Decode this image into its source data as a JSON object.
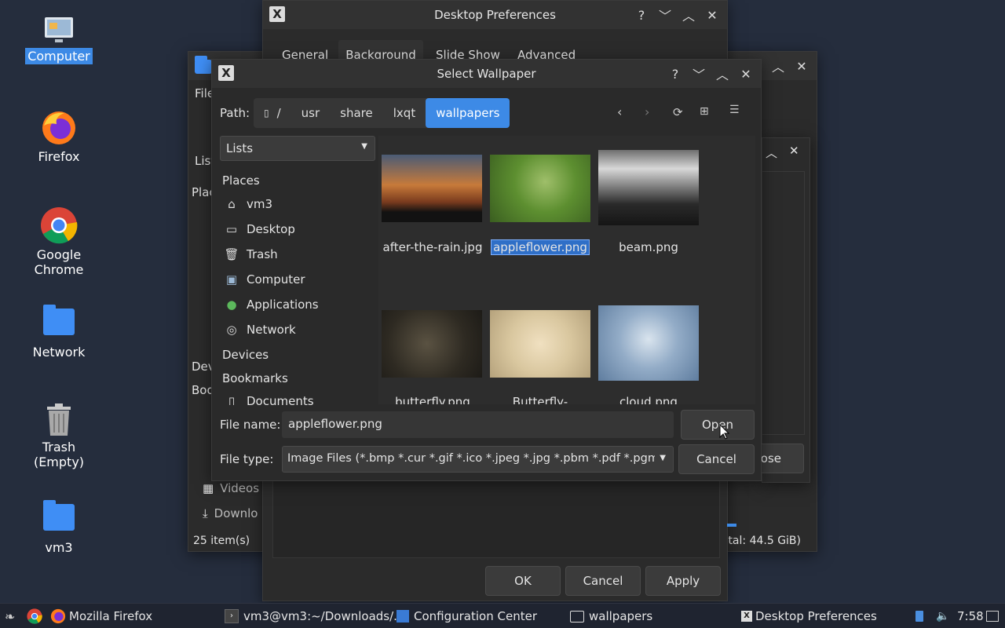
{
  "desktop": {
    "icons": [
      {
        "label": "Computer"
      },
      {
        "label": "Firefox"
      },
      {
        "label": "Google\nChrome"
      },
      {
        "label": "Network"
      },
      {
        "label": "Trash (Empty)"
      },
      {
        "label": "vm3"
      }
    ]
  },
  "bg_filemanager": {
    "menu_partial": "File",
    "sidebar_partial": [
      "List",
      "Plac",
      "Dev",
      "Boo"
    ],
    "items": [
      "Videos",
      "Downlo"
    ],
    "status": "25 item(s)",
    "free": "otal: 44.5 GiB)"
  },
  "desktop_prefs": {
    "title": "Desktop Preferences",
    "tabs": [
      "General",
      "Background",
      "Slide Show",
      "Advanced"
    ],
    "ok": "OK",
    "cancel": "Cancel",
    "apply": "Apply",
    "close_partial": "ose"
  },
  "dialog": {
    "title": "Select Wallpaper",
    "path_label": "Path:",
    "path_segments": [
      "/",
      "usr",
      "share",
      "lxqt",
      "wallpapers"
    ],
    "view_mode": "Lists",
    "places_header": "Places",
    "places": [
      "vm3",
      "Desktop",
      "Trash",
      "Computer",
      "Applications",
      "Network"
    ],
    "devices_header": "Devices",
    "bookmarks_header": "Bookmarks",
    "bookmarks": [
      "Documents"
    ],
    "files": [
      {
        "name": "after-the-rain.jpg"
      },
      {
        "name": "appleflower.png"
      },
      {
        "name": "beam.png"
      },
      {
        "name": "butterfly.png"
      },
      {
        "name": "Butterfly-"
      },
      {
        "name": "cloud.png"
      }
    ],
    "filename_label": "File name:",
    "filename_value": "appleflower.png",
    "filetype_label": "File type:",
    "filetype_value": "Image Files (*.bmp *.cur *.gif *.ico *.jpeg *.jpg *.pbm *.pdf *.pgm",
    "open": "Open",
    "cancel": "Cancel"
  },
  "taskbar": {
    "firefox": "Mozilla Firefox",
    "terminal": "vm3@vm3:~/Downloads/...",
    "config": "Configuration Center",
    "wallpapers": "wallpapers",
    "prefs": "Desktop Preferences",
    "clock": "7:58"
  },
  "colors": {
    "accent": "#3d8ae6",
    "desktop_bg": "#252d3d",
    "window_bg": "#2b2b2b"
  }
}
